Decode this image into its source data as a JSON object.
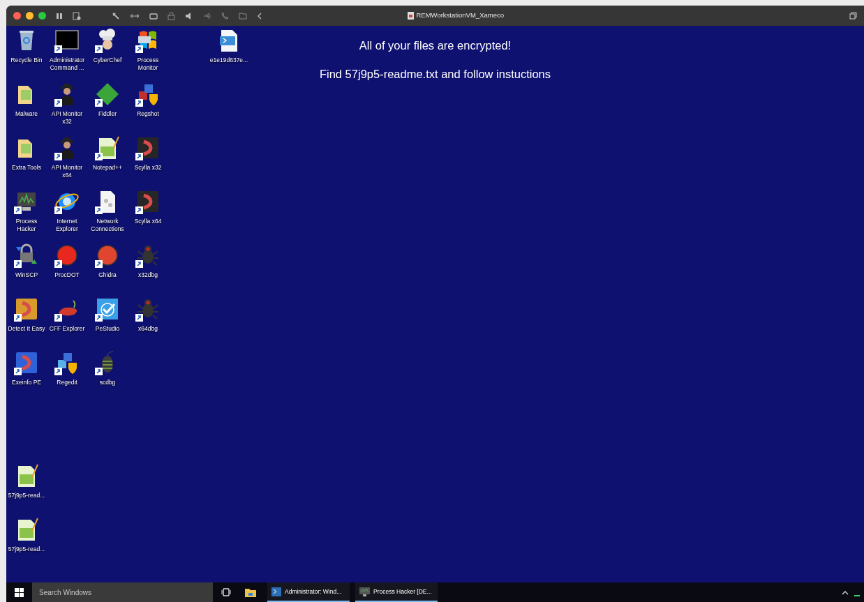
{
  "vm_window": {
    "title": "REMWorkstationVM_Xameco"
  },
  "desktop": {
    "columns": [
      {
        "icons": [
          {
            "label": "Recycle Bin",
            "kind": "bin",
            "shortcut": false
          },
          {
            "label": "Malware",
            "kind": "folder",
            "shortcut": false
          },
          {
            "label": "Extra Tools",
            "kind": "folder",
            "shortcut": false
          },
          {
            "label": "Process Hacker",
            "kind": "monitor",
            "shortcut": true
          },
          {
            "label": "WinSCP",
            "kind": "lock",
            "shortcut": true
          },
          {
            "label": "Detect It Easy",
            "kind": "tile",
            "color": "#d89a2b",
            "shortcut": true
          },
          {
            "label": "Exeinfo PE",
            "kind": "tile",
            "color": "#2f62d8",
            "shortcut": true
          }
        ]
      },
      {
        "icons": [
          {
            "label": "Administrator Command ...",
            "kind": "terminal",
            "shortcut": true
          },
          {
            "label": "API Monitor x32",
            "kind": "spy",
            "shortcut": true
          },
          {
            "label": "API Monitor x64",
            "kind": "spy",
            "shortcut": true
          },
          {
            "label": "Internet Explorer",
            "kind": "globe",
            "shortcut": true
          },
          {
            "label": "ProcDOT",
            "kind": "circle",
            "color": "#e8281e",
            "shortcut": true
          },
          {
            "label": "CFF Explorer",
            "kind": "pepper",
            "shortcut": true
          },
          {
            "label": "Regedit",
            "kind": "cubes",
            "color": "#5ab0e8",
            "shortcut": true
          }
        ]
      },
      {
        "icons": [
          {
            "label": "CyberChef",
            "kind": "chef",
            "shortcut": true
          },
          {
            "label": "Fiddler",
            "kind": "diamond",
            "shortcut": true
          },
          {
            "label": "Notepad++",
            "kind": "notepad",
            "shortcut": true
          },
          {
            "label": "Network Connections",
            "kind": "file",
            "shortcut": true
          },
          {
            "label": "Ghidra",
            "kind": "circle",
            "color": "#e0452f",
            "shortcut": true
          },
          {
            "label": "PeStudio",
            "kind": "check",
            "shortcut": true
          },
          {
            "label": "scdbg",
            "kind": "beetle",
            "shortcut": true
          }
        ]
      },
      {
        "icons": [
          {
            "label": "Process Monitor",
            "kind": "window",
            "shortcut": true
          },
          {
            "label": "Regshot",
            "kind": "cubes",
            "color": "#c0302a",
            "shortcut": true
          },
          {
            "label": "Scylla x32",
            "kind": "tile",
            "color": "#262626",
            "shortcut": true
          },
          {
            "label": "Scylla x64",
            "kind": "tile",
            "color": "#262626",
            "shortcut": true
          },
          {
            "label": "x32dbg",
            "kind": "bug",
            "shortcut": true
          },
          {
            "label": "x64dbg",
            "kind": "bug",
            "shortcut": true
          }
        ]
      }
    ],
    "loose_icons": [
      {
        "label": "e1e19d637e...",
        "kind": "script",
        "shortcut": false
      }
    ],
    "message": [
      "All of your files are encrypted!",
      "Find 57j9p5-readme.txt and follow instuctions"
    ],
    "bottom_icons": [
      {
        "label": "57j9p5-read...",
        "kind": "notepad",
        "shortcut": false
      },
      {
        "label": "57j9p5-read...",
        "kind": "notepad",
        "shortcut": false
      }
    ]
  },
  "taskbar": {
    "search": {
      "placeholder": "Search Windows"
    },
    "apps": [
      {
        "label": "Administrator: Wind...",
        "kind": "terminal"
      },
      {
        "label": "Process Hacker [DE...",
        "kind": "monitor"
      }
    ]
  }
}
